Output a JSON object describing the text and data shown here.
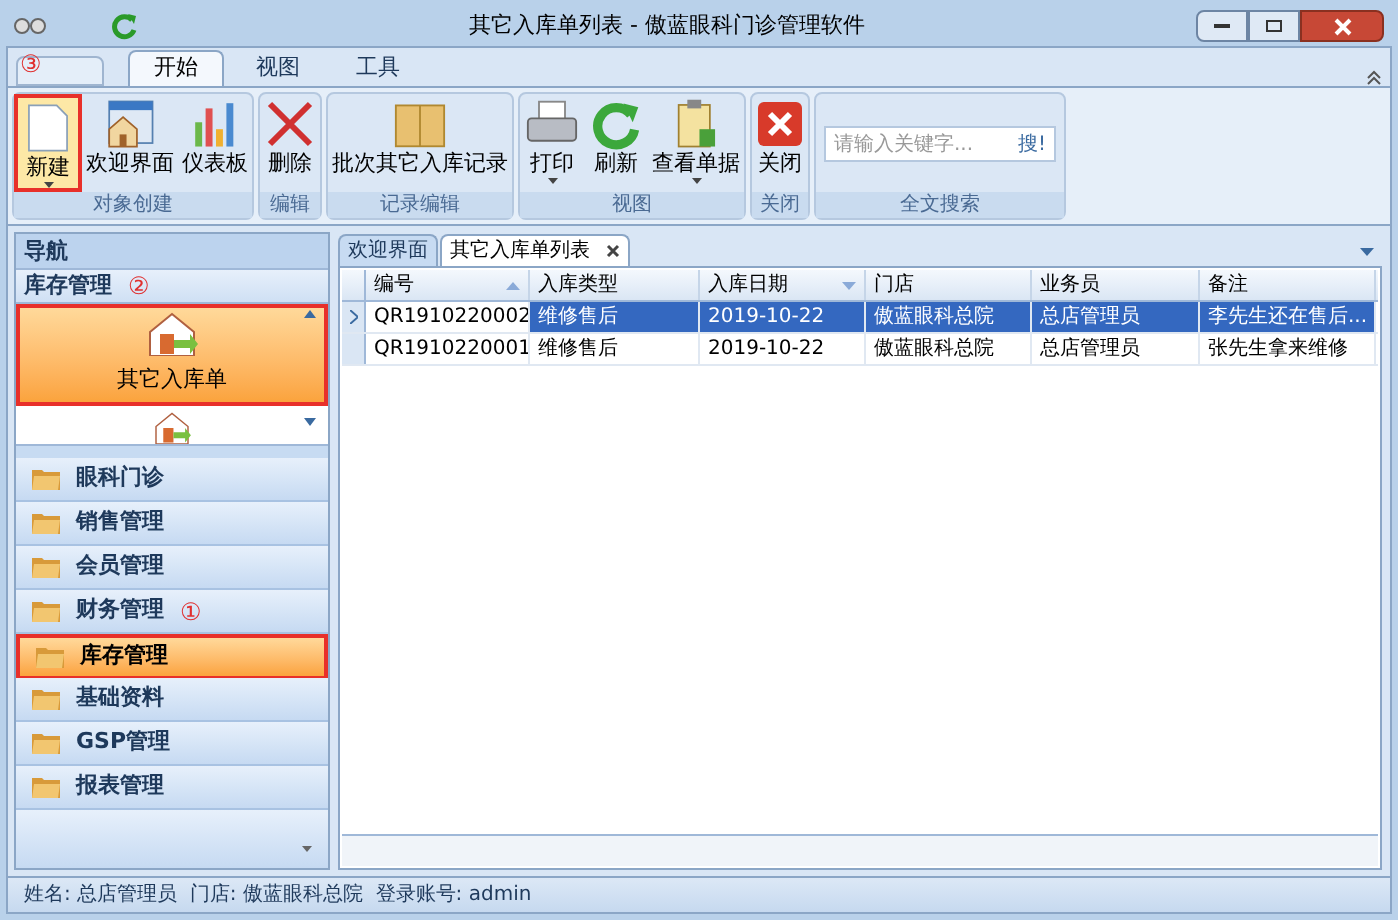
{
  "window": {
    "title": "其它入库单列表 - 傲蓝眼科门诊管理软件"
  },
  "ribbon": {
    "annotation": "③",
    "tabs": [
      {
        "label": "开始",
        "selected": true
      },
      {
        "label": "视图",
        "selected": false
      },
      {
        "label": "工具",
        "selected": false
      }
    ],
    "groups": [
      {
        "label": "对象创建",
        "buttons": [
          {
            "label": "新建",
            "kind": "page",
            "dropdown": true,
            "highlighted": true
          },
          {
            "label": "欢迎界面",
            "kind": "home",
            "dropdown": false,
            "highlighted": false
          },
          {
            "label": "仪表板",
            "kind": "bars",
            "dropdown": false,
            "highlighted": false
          }
        ]
      },
      {
        "label": "编辑",
        "buttons": [
          {
            "label": "删除",
            "kind": "cross",
            "dropdown": false,
            "highlighted": false
          }
        ]
      },
      {
        "label": "记录编辑",
        "buttons": [
          {
            "label": "批次其它入库记录",
            "kind": "box",
            "dropdown": false,
            "highlighted": false
          }
        ]
      },
      {
        "label": "视图",
        "buttons": [
          {
            "label": "打印",
            "kind": "printer",
            "dropdown": true,
            "highlighted": false
          },
          {
            "label": "刷新",
            "kind": "refresh",
            "dropdown": false,
            "highlighted": false
          },
          {
            "label": "查看单据",
            "kind": "clipboard",
            "dropdown": true,
            "highlighted": false
          }
        ]
      },
      {
        "label": "关闭",
        "buttons": [
          {
            "label": "关闭",
            "kind": "close",
            "dropdown": false,
            "highlighted": false
          }
        ]
      }
    ],
    "search": {
      "label": "全文搜索",
      "placeholder": "请输入关键字...",
      "button": "搜!"
    }
  },
  "nav": {
    "title": "导航",
    "section": {
      "label": "库存管理",
      "annotation": "②"
    },
    "items": [
      {
        "label": "其它入库单",
        "selected": true,
        "highlighted": true
      }
    ],
    "modules": [
      {
        "label": "眼科门诊",
        "selected": false,
        "highlighted": false
      },
      {
        "label": "销售管理",
        "selected": false,
        "highlighted": false
      },
      {
        "label": "会员管理",
        "selected": false,
        "highlighted": false
      },
      {
        "label": "财务管理",
        "selected": false,
        "highlighted": false,
        "annotation": "①"
      },
      {
        "label": "库存管理",
        "selected": true,
        "highlighted": true
      },
      {
        "label": "基础资料",
        "selected": false,
        "highlighted": false
      },
      {
        "label": "GSP管理",
        "selected": false,
        "highlighted": false
      },
      {
        "label": "报表管理",
        "selected": false,
        "highlighted": false
      }
    ]
  },
  "doc_tabs": [
    {
      "label": "欢迎界面",
      "selected": false,
      "closable": false
    },
    {
      "label": "其它入库单列表",
      "selected": true,
      "closable": true
    }
  ],
  "table": {
    "columns": [
      {
        "label": "编号",
        "kind": "ascending"
      },
      {
        "label": "入库类型",
        "kind": "plain"
      },
      {
        "label": "入库日期",
        "kind": "descending"
      },
      {
        "label": "门店",
        "kind": "plain"
      },
      {
        "label": "业务员",
        "kind": "plain"
      },
      {
        "label": "备注",
        "kind": "plain"
      }
    ],
    "rows": [
      {
        "selected": true,
        "cells": [
          "QR1910220002",
          "维修售后",
          "2019-10-22",
          "傲蓝眼科总院",
          "总店管理员",
          "李先生还在售后..."
        ]
      },
      {
        "selected": false,
        "cells": [
          "QR1910220001",
          "维修售后",
          "2019-10-22",
          "傲蓝眼科总院",
          "总店管理员",
          "张先生拿来维修"
        ]
      }
    ]
  },
  "status_bar": {
    "text": "姓名: 总店管理员  门店: 傲蓝眼科总院  登录账号: admin"
  }
}
